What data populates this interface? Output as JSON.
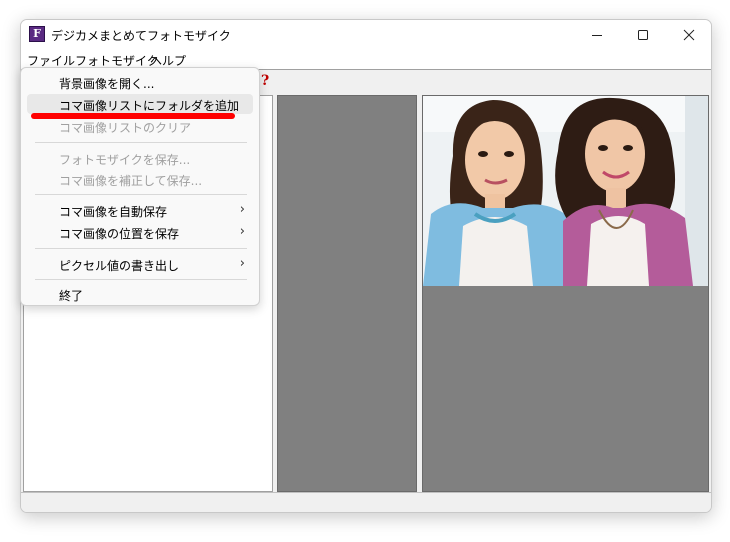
{
  "window": {
    "title": "デジカメまとめてフォトモザイク",
    "app_icon_letter": "F"
  },
  "menubar": {
    "items": [
      "ファイル",
      "フォトモザイク",
      "ヘルプ"
    ]
  },
  "toolbar": {
    "help_icon_glyph": "?"
  },
  "file_menu": {
    "items": [
      {
        "label": "背景画像を開く...",
        "enabled": true,
        "submenu": false
      },
      {
        "label": "コマ画像リストにフォルダを追加",
        "enabled": true,
        "submenu": false,
        "highlighted": true
      },
      {
        "label": "コマ画像リストのクリア",
        "enabled": false,
        "submenu": false
      },
      {
        "label": "フォトモザイクを保存...",
        "enabled": false,
        "submenu": false
      },
      {
        "label": "コマ画像を補正して保存...",
        "enabled": false,
        "submenu": false
      },
      {
        "label": "コマ画像を自動保存",
        "enabled": true,
        "submenu": true
      },
      {
        "label": "コマ画像の位置を保存",
        "enabled": true,
        "submenu": true
      },
      {
        "label": "ピクセル値の書き出し",
        "enabled": true,
        "submenu": true
      },
      {
        "label": "終了",
        "enabled": true,
        "submenu": false
      }
    ],
    "submenu_arrow": "›"
  },
  "colors": {
    "pane_gray": "#808080",
    "annotation_red": "#ff0000",
    "help_icon": "#c00000"
  }
}
